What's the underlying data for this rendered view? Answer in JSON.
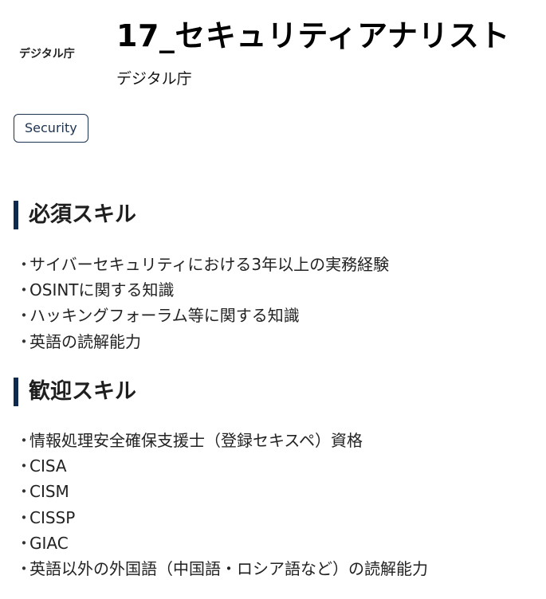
{
  "header": {
    "logo_text": "デジタル庁",
    "title": "17_セキュリティアナリスト",
    "organization": "デジタル庁"
  },
  "tags": [
    "Security"
  ],
  "colors": {
    "accent_bar": "#0e2a4e",
    "tag_border": "#1c3350"
  },
  "sections": [
    {
      "heading": "必須スキル",
      "items": [
        "サイバーセキュリティにおける3年以上の実務経験",
        "OSINTに関する知識",
        "ハッキングフォーラム等に関する知識",
        "英語の読解能力"
      ]
    },
    {
      "heading": "歓迎スキル",
      "items": [
        "情報処理安全確保支援士（登録セキスペ）資格",
        "CISA",
        "CISM",
        "CISSP",
        "GIAC",
        "英語以外の外国語（中国語・ロシア語など）の読解能力"
      ]
    }
  ]
}
